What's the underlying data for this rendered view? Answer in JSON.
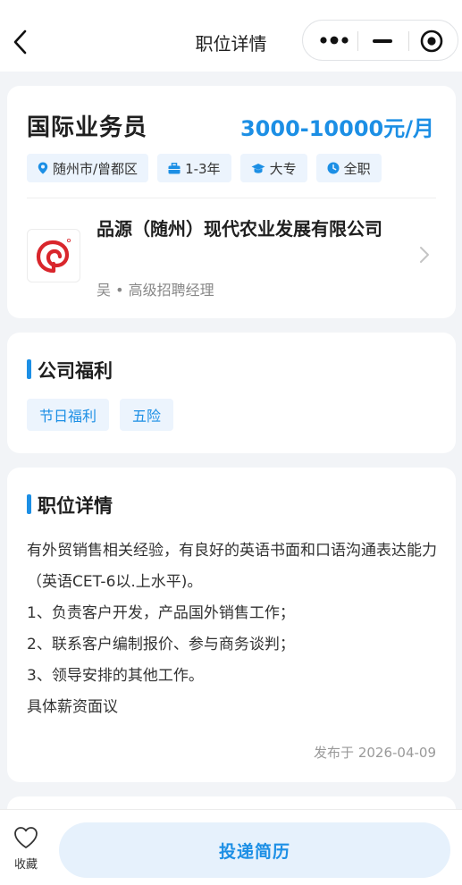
{
  "nav": {
    "title": "职位详情"
  },
  "job": {
    "title": "国际业务员",
    "salary": "3000-10000元/月",
    "tags": [
      {
        "icon": "location-pin-icon",
        "label": "随州市/曾都区"
      },
      {
        "icon": "briefcase-icon",
        "label": "1-3年"
      },
      {
        "icon": "graduation-cap-icon",
        "label": "大专"
      },
      {
        "icon": "clock-icon",
        "label": "全职"
      }
    ]
  },
  "company": {
    "name": "品源（随州）现代农业发展有限公司",
    "contact": "吴 • 高级招聘经理",
    "logo_color": "#d9262c"
  },
  "benefits": {
    "title": "公司福利",
    "items": [
      "节日福利",
      "五险"
    ]
  },
  "details": {
    "title": "职位详情",
    "lines": [
      "有外贸销售相关经验，有良好的英语书面和口语沟通表达能力（英语CET-6以.上水平)。",
      "1、负责客户开发，产品国外销售工作；",
      "2、联系客户编制报价、参与商务谈判；",
      "3、领导安排的其他工作。",
      "具体薪资面议"
    ],
    "published": "发布于 2026-04-09"
  },
  "footer": {
    "favorite_label": "收藏",
    "apply_label": "投递简历"
  },
  "colors": {
    "accent": "#1c8fe5",
    "tag_bg": "#ecf4fd",
    "page_bg": "#f2f4f7"
  }
}
